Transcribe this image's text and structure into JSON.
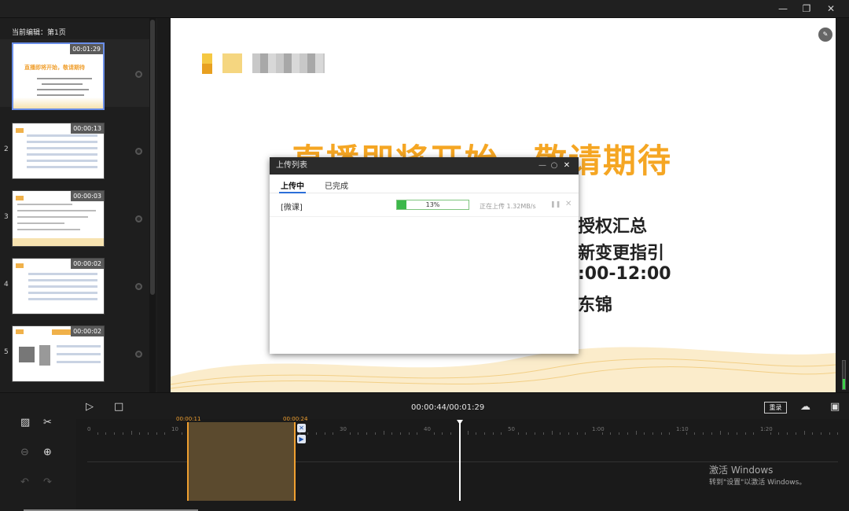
{
  "window": {
    "min": "—",
    "max": "❐",
    "close": "✕"
  },
  "sidebar": {
    "current_label": "当前编辑：第1页",
    "pages": [
      {
        "num": "",
        "time": "00:01:29"
      },
      {
        "num": "2",
        "time": "00:00:13"
      },
      {
        "num": "3",
        "time": "00:00:03"
      },
      {
        "num": "4",
        "time": "00:00:02"
      },
      {
        "num": "5",
        "time": "00:00:02"
      }
    ],
    "thumb1_title": "直播即将开始，敬请期待"
  },
  "slide": {
    "title": "直播即将开始，敬请期待",
    "lines": [
      "授权汇总",
      "新变更指引",
      ":00-12:00",
      "东锦"
    ],
    "tool_icon": "edit-icon"
  },
  "upload_dialog": {
    "title": "上传列表",
    "tabs": [
      "上传中",
      "已完成"
    ],
    "item": {
      "name": "[微课]",
      "progress_label": "13%",
      "progress_fraction": 0.13,
      "status": "正在上传 1.32MB/s"
    }
  },
  "timeline": {
    "current_time": "00:00:44/00:01:29",
    "record_label": "重录",
    "clip_start": "00:00:11",
    "clip_end": "00:00:24",
    "ruler_labels": [
      "0",
      "10",
      "20",
      "30",
      "40",
      "50",
      "1:00",
      "1:10",
      "1:20"
    ],
    "playhead_seconds": 44
  },
  "watermark": {
    "line1": "激活 Windows",
    "line2": "转到\"设置\"以激活 Windows。"
  },
  "colors": {
    "accent_orange": "#f0a030",
    "progress_green": "#3cb84a",
    "slide_title": "#f5a623"
  }
}
